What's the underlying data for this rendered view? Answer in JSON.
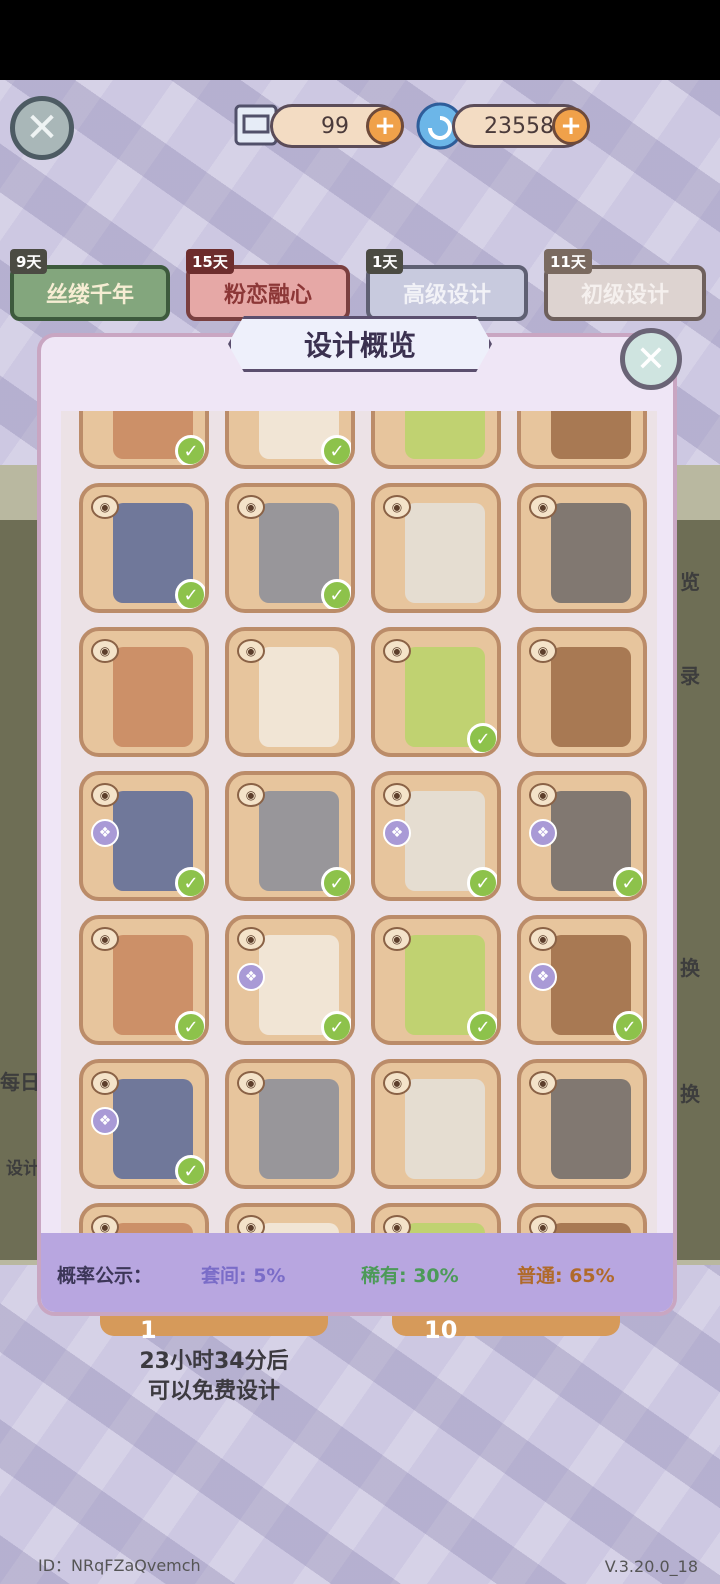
{
  "resources": {
    "scroll_count": "99",
    "gem_count": "23558",
    "plus": "+"
  },
  "tabs": [
    {
      "days": "9天",
      "label": "丝缕千年"
    },
    {
      "days": "15天",
      "label": "粉恋融心"
    },
    {
      "days": "1天",
      "label": "高级设计"
    },
    {
      "days": "11天",
      "label": "初级设计"
    }
  ],
  "modal": {
    "title": "设计概览",
    "close": "✕"
  },
  "probability": {
    "label": "概率公示：",
    "suite": "套间: 5%",
    "rare": "稀有: 30%",
    "normal": "普通: 65%"
  },
  "background_text": {
    "right1": "览",
    "right2": "录",
    "right3": "换",
    "right4": "换",
    "left1": "每日",
    "left2": "设计"
  },
  "draw_buttons": {
    "single": "1",
    "ten": "10"
  },
  "timer": {
    "line1": "23小时34分后",
    "line2": "可以免费设计"
  },
  "footer": {
    "id": "ID：NRqFZaQvemch",
    "version": "V.3.20.0_18"
  },
  "grid": {
    "rows": [
      [
        "checked",
        "checked",
        "none",
        "none"
      ],
      [
        "none",
        "none",
        "checked",
        "none"
      ],
      [
        "checked",
        "checked",
        "checked",
        "checked"
      ],
      [
        "checked",
        "checked",
        "checked",
        "checked"
      ],
      [
        "checked",
        "none",
        "none",
        "none"
      ],
      [
        "none",
        "checked",
        "none",
        "none"
      ]
    ]
  },
  "colors": {
    "accent_orange": "#f0a14a",
    "check_green": "#8dc24b",
    "suite_purple": "#7a6cc8",
    "rare_green": "#4c9a58",
    "normal_brown": "#b06a2a"
  }
}
